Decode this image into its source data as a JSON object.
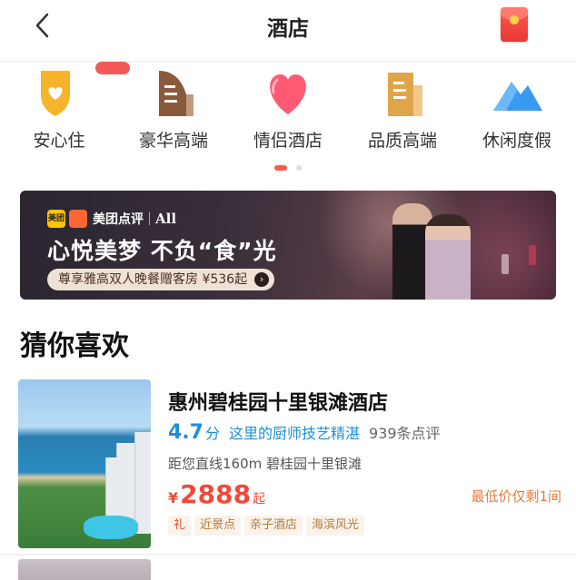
{
  "header": {
    "title": "酒店",
    "back_icon": "chevron-left-icon",
    "red_packet_icon": "red-envelope-icon"
  },
  "categories": [
    {
      "label": "安心住",
      "icon": "shield-heart-icon"
    },
    {
      "label": "豪华高端",
      "icon": "luxury-building-icon"
    },
    {
      "label": "情侣酒店",
      "icon": "heart-icon"
    },
    {
      "label": "品质高端",
      "icon": "quality-building-icon"
    },
    {
      "label": "休闲度假",
      "icon": "mountain-icon"
    }
  ],
  "pager": {
    "active_index": 0,
    "count": 2
  },
  "banner": {
    "brand_meituan": "美团",
    "brand_dianping": "美团点评",
    "brand_all": "All",
    "slogan": "心悦美梦 不负“食”光",
    "cta": "尊享雅高双人晚餐赠客房 ¥536起"
  },
  "section": {
    "title": "猜你喜欢"
  },
  "hotel": {
    "name": "惠州碧桂园十里银滩酒店",
    "score": "4.7",
    "score_unit": "分",
    "tagline": "这里的厨师技艺精湛",
    "reviews": "939条点评",
    "distance": "距您直线160m 碧桂园十里银滩",
    "currency": "¥",
    "price": "2888",
    "price_suffix": "起",
    "low_notice": "最低价仅剩1间",
    "tags": [
      "礼",
      "近景点",
      "亲子酒店",
      "海滨风光"
    ]
  },
  "colors": {
    "accent_red": "#f04a3a",
    "score_blue": "#1e8fd8",
    "low_orange": "#e87a3c"
  }
}
